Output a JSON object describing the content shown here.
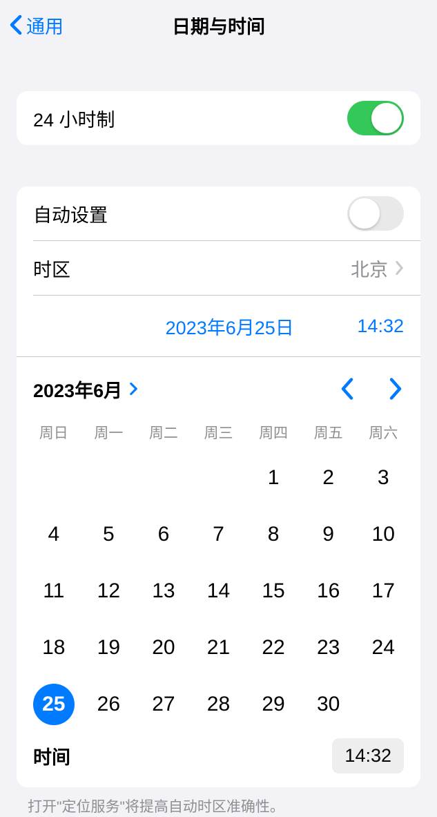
{
  "header": {
    "back_label": "通用",
    "title": "日期与时间"
  },
  "settings": {
    "twenty_four_hour_label": "24 小时制",
    "twenty_four_hour_on": true,
    "auto_set_label": "自动设置",
    "auto_set_on": false,
    "timezone_label": "时区",
    "timezone_value": "北京"
  },
  "datetime": {
    "date_display": "2023年6月25日",
    "time_display": "14:32"
  },
  "calendar": {
    "month_label": "2023年6月",
    "weekdays": [
      "周日",
      "周一",
      "周二",
      "周三",
      "周四",
      "周五",
      "周六"
    ],
    "leading_blanks": 4,
    "days": [
      1,
      2,
      3,
      4,
      5,
      6,
      7,
      8,
      9,
      10,
      11,
      12,
      13,
      14,
      15,
      16,
      17,
      18,
      19,
      20,
      21,
      22,
      23,
      24,
      25,
      26,
      27,
      28,
      29,
      30
    ],
    "selected_day": 25
  },
  "time_row": {
    "label": "时间",
    "value": "14:32"
  },
  "footer_note": "打开\"定位服务\"将提高自动时区准确性。"
}
